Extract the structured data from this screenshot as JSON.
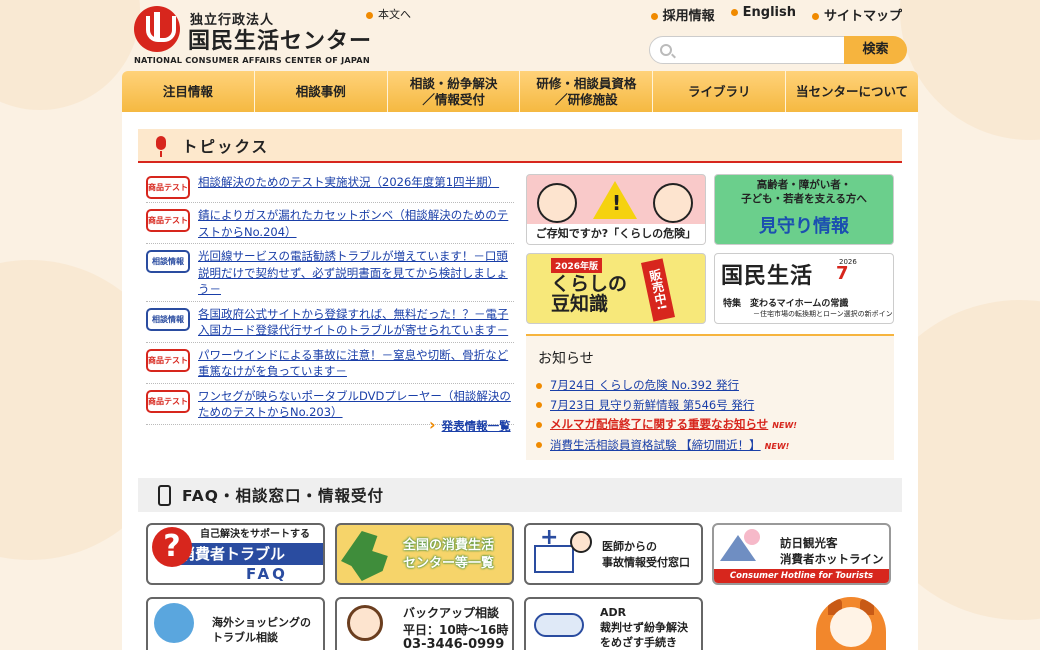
{
  "header": {
    "logo_small": "独立行政法人",
    "logo_main": "国民生活センター",
    "logo_en": "NATIONAL CONSUMER AFFAIRS CENTER OF JAPAN",
    "skip_link": "本文へ",
    "top_links": [
      "採用情報",
      "English",
      "サイトマップ"
    ],
    "search_placeholder": "",
    "search_button": "検索"
  },
  "nav": [
    "注目情報",
    "相談事例",
    "相談・紛争解決\n／情報受付",
    "研修・相談員資格\n／研修施設",
    "ライブラリ",
    "当センターについて"
  ],
  "topics": {
    "title": "トピックス",
    "items": [
      {
        "badge": "商品テスト",
        "kind": "test",
        "text": "相談解決のためのテスト実施状況（2026年度第1四半期）"
      },
      {
        "badge": "商品テスト",
        "kind": "test",
        "text": "錆によりガスが漏れたカセットボンベ（相談解決のためのテストからNo.204）"
      },
      {
        "badge": "相談情報",
        "kind": "consult",
        "text": "光回線サービスの電話勧誘トラブルが増えています！－口頭説明だけで契約せず、必ず説明書面を見てから検討しましょう－"
      },
      {
        "badge": "相談情報",
        "kind": "consult",
        "text": "各国政府公式サイトから登録すれば、無料だった！？－電子入国カード登録代行サイトのトラブルが寄せられています－"
      },
      {
        "badge": "商品テスト",
        "kind": "test",
        "text": "パワーウインドによる事故に注意！－窒息や切断、骨折など重篤なけがを負っています－"
      },
      {
        "badge": "商品テスト",
        "kind": "test",
        "text": "ワンセグが映らないポータブルDVDプレーヤー（相談解決のためのテストからNo.203）"
      }
    ],
    "more": "発表情報一覧"
  },
  "banners": {
    "kurashi_kiken_caption": "ご存知ですか?「くらしの危険」",
    "mimamori_sub": "高齢者・障がい者・\n子ども・若者を支える方へ",
    "mimamori_main": "見守り情報",
    "mamechishiki_tag": "2026年版",
    "mamechishiki_name": "くらしの豆知識",
    "mamechishiki_sale": "販売中!",
    "kokumin_name": "国民生活",
    "kokumin_year": "2026",
    "kokumin_month": "7",
    "kokumin_feature": "特集　変わるマイホームの常識",
    "kokumin_feature_sub": "－住宅市場の転換期とローン選択の新ポイント－"
  },
  "notice": {
    "title": "お知らせ",
    "items": [
      {
        "text": "7月24日 くらしの危険 No.392 発行",
        "highlight": false,
        "new": false
      },
      {
        "text": "7月23日 見守り新鮮情報 第546号 発行",
        "highlight": false,
        "new": false
      },
      {
        "text": "メルマガ配信終了に関する重要なお知らせ",
        "highlight": true,
        "new": true
      },
      {
        "text": "消費生活相談員資格試験 【締切間近！】",
        "highlight": false,
        "new": true
      }
    ],
    "new_label": "NEW!"
  },
  "faq": {
    "title": "FAQ・相談窓口・情報受付",
    "cards": {
      "faq_sub": "自己解決をサポートする",
      "faq_main": "消費者トラブル",
      "faq_tail": "FAQ",
      "centers": "全国の消費生活\nセンター等一覧",
      "doctors": "医師からの\n事故情報受付窓口",
      "tourists": "訪日観光客\n消費者ホットライン",
      "tourists_en": "Consumer Hotline for Tourists",
      "overseas": "海外ショッピングの\nトラブル相談",
      "backup": "バックアップ相談\n平日：10時～16時",
      "backup_tel": "03-3446-0999",
      "adr": "ADR\n裁判せず紛争解決\nをめざす手続き"
    }
  }
}
